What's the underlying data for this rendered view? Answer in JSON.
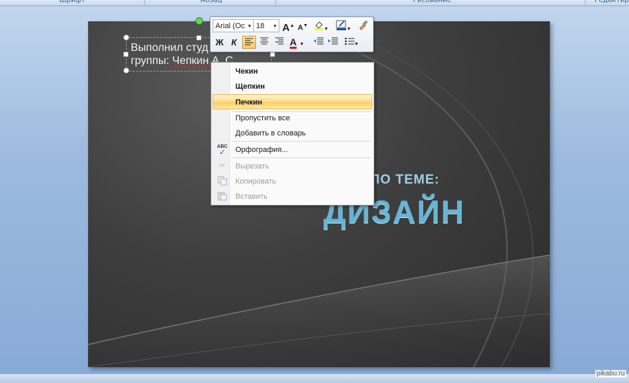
{
  "ribbon": {
    "groups": [
      "Шрифт",
      "Абзац",
      "Рисование",
      "Редактиро"
    ]
  },
  "slide": {
    "textbox_line1": "Выполнил студ",
    "textbox_line2_prefix": "группы: ",
    "textbox_misspelled": "Чепкин",
    "textbox_line2_suffix": " А. С.",
    "subtitle": "ПО ТЕМЕ:",
    "title": "ДИЗАЙН"
  },
  "mini_toolbar": {
    "font_name": "Arial (Ос",
    "font_size": "18",
    "bold_label": "Ж",
    "italic_label": "К",
    "grow_font": "A",
    "shrink_font": "A",
    "font_color_letter": "A",
    "highlight_color": "#ffeb3b",
    "font_color": "#d01c1c"
  },
  "context_menu": {
    "suggestions": [
      "Чекин",
      "Щепкин",
      "Печкин"
    ],
    "skip_all": "Пропустить все",
    "add_to_dictionary": "Добавить в словарь",
    "spelling": "Орфография...",
    "cut": "Вырезать",
    "copy": "Копировать",
    "paste": "Вставить",
    "spelling_icon_text": "ABC"
  },
  "watermark": "pikabu.ru"
}
